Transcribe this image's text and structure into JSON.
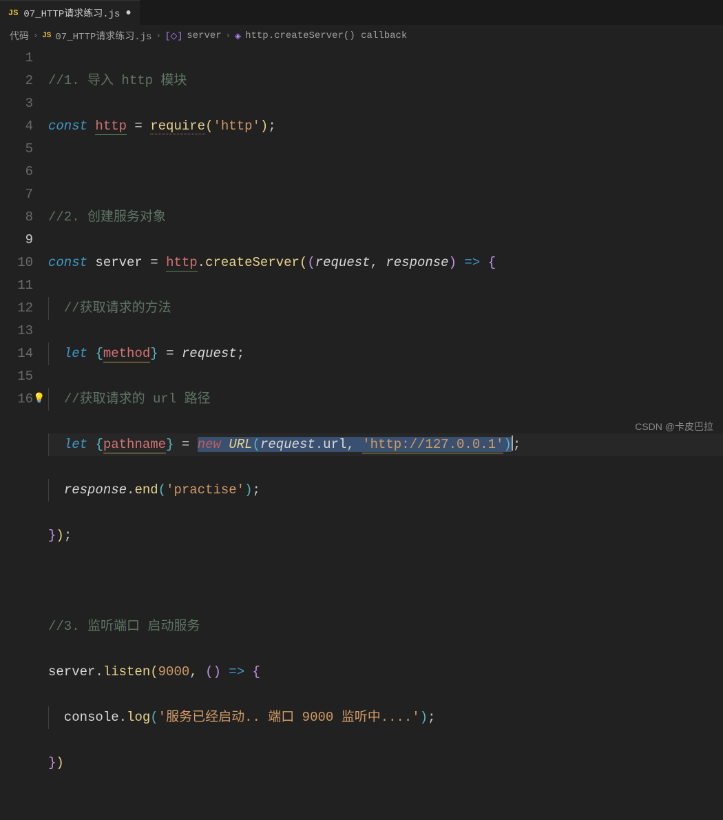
{
  "tab": {
    "icon": "JS",
    "label": "07_HTTP请求练习.js",
    "modified": "●"
  },
  "breadcrumbs": {
    "items": [
      "代码",
      "07_HTTP请求练习.js",
      "server",
      "http.createServer() callback"
    ],
    "jsIcon": "JS"
  },
  "lineNumbers": [
    "1",
    "2",
    "3",
    "4",
    "5",
    "6",
    "7",
    "8",
    "9",
    "10",
    "11",
    "12",
    "13",
    "14",
    "15",
    "16"
  ],
  "code": {
    "l1": {
      "comment": "//1. 导入 http 模块"
    },
    "l2": {
      "const": "const",
      "name": "http",
      "eq": " = ",
      "req": "require",
      "open": "(",
      "str": "'http'",
      "close": ")",
      "semi": ";"
    },
    "l4": {
      "comment": "//2. 创建服务对象"
    },
    "l5": {
      "const": "const",
      "name": "server",
      "eq": " = ",
      "obj": "http",
      "dot": ".",
      "method": "createServer",
      "o1": "(",
      "o2": "(",
      "p1": "request",
      "comma": ", ",
      "p2": "response",
      "c2": ")",
      "arrow": " => ",
      "brace": "{"
    },
    "l6": {
      "comment": "//获取请求的方法"
    },
    "l7": {
      "let": "let",
      "ob": "{",
      "var": "method",
      "cb": "}",
      "eq": " = ",
      "src": "request",
      "semi": ";"
    },
    "l8": {
      "comment": "//获取请求的 url 路径"
    },
    "l9": {
      "let": "let",
      "ob": "{",
      "var": "pathname",
      "cb": "}",
      "eq": " = ",
      "new": "new",
      "sp": " ",
      "cls": "URL",
      "op": "(",
      "req": "request",
      "dot": ".",
      "prop": "url",
      "comma": ", ",
      "str": "'http://127.0.0.1'",
      "cp": ")",
      "semi": ";"
    },
    "l10": {
      "obj": "response",
      "dot": ".",
      "method": "end",
      "op": "(",
      "str": "'practise'",
      "cp": ")",
      "semi": ";"
    },
    "l11": {
      "brace": "}",
      "cp": ")",
      "semi": ";"
    },
    "l13": {
      "comment": "//3. 监听端口 启动服务"
    },
    "l14": {
      "obj": "server",
      "dot": ".",
      "method": "listen",
      "op": "(",
      "num": "9000",
      "comma": ", ",
      "o2": "(",
      "c2": ")",
      "arrow": " => ",
      "brace": "{"
    },
    "l15": {
      "obj": "console",
      "dot": ".",
      "method": "log",
      "op": "(",
      "str": "'服务已经启动.. 端口 9000 监听中....'",
      "cp": ")",
      "semi": ";"
    },
    "l16": {
      "brace": "}",
      "cp": ")"
    }
  },
  "watermark": "CSDN @卡皮巴拉"
}
